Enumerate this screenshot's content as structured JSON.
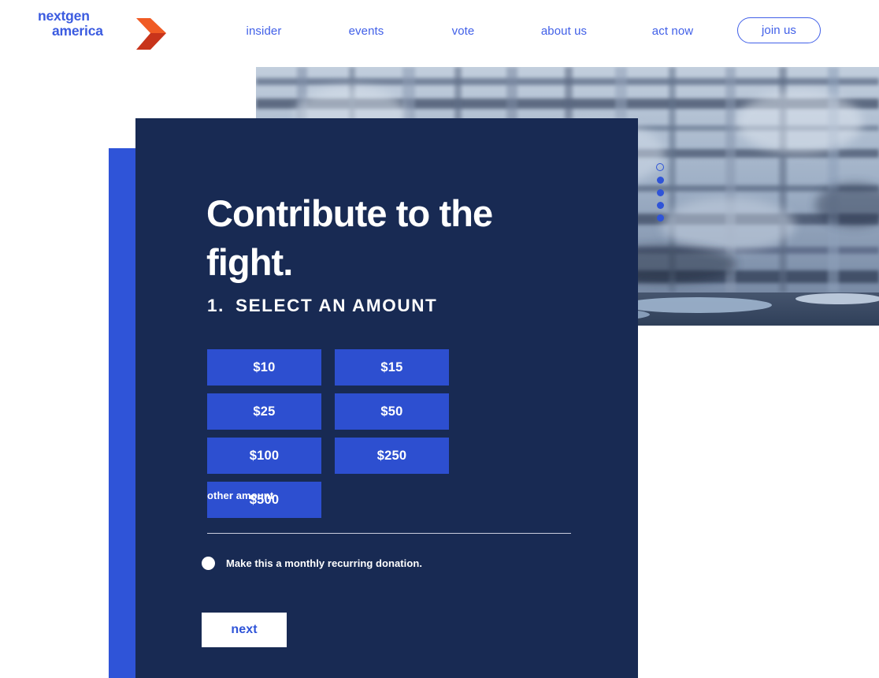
{
  "header": {
    "logo": {
      "line1": "nextgen",
      "line2": "america",
      "chevron_icon": "chevron-right-icon",
      "text_color": "#3B5BE0",
      "chevron_color": "#E8491F"
    },
    "nav_items": [
      {
        "label": "insider"
      },
      {
        "label": "events"
      },
      {
        "label": "vote"
      },
      {
        "label": "about us"
      },
      {
        "label": "act now"
      }
    ],
    "cta": {
      "label": "join us",
      "color": "#4160E8"
    }
  },
  "hero": {
    "image_alt": "glacier ice cliff above water",
    "slider": {
      "dots": [
        {
          "active": true
        },
        {
          "active": false
        },
        {
          "active": false
        },
        {
          "active": false
        },
        {
          "active": false
        }
      ],
      "dot_color": "#2F54D8"
    }
  },
  "panel": {
    "background": "#182A53",
    "accent_bar_color": "#2F54D8",
    "headline": "Contribute to the fight.",
    "step": {
      "number": "1.",
      "title": "SELECT AN AMOUNT"
    },
    "amounts": [
      {
        "label": "$10",
        "value": 10
      },
      {
        "label": "$15",
        "value": 15
      },
      {
        "label": "$25",
        "value": 25
      },
      {
        "label": "$50",
        "value": 50
      },
      {
        "label": "$100",
        "value": 100
      },
      {
        "label": "$250",
        "value": 250
      },
      {
        "label": "$500",
        "value": 500
      }
    ],
    "amount_button_color": "#2D4FD0",
    "other_amount": {
      "label": "other amount",
      "value": "",
      "placeholder": ""
    },
    "recurring": {
      "label": "Make this a monthly recurring donation.",
      "checked": false
    },
    "next_button": {
      "label": "next"
    }
  }
}
